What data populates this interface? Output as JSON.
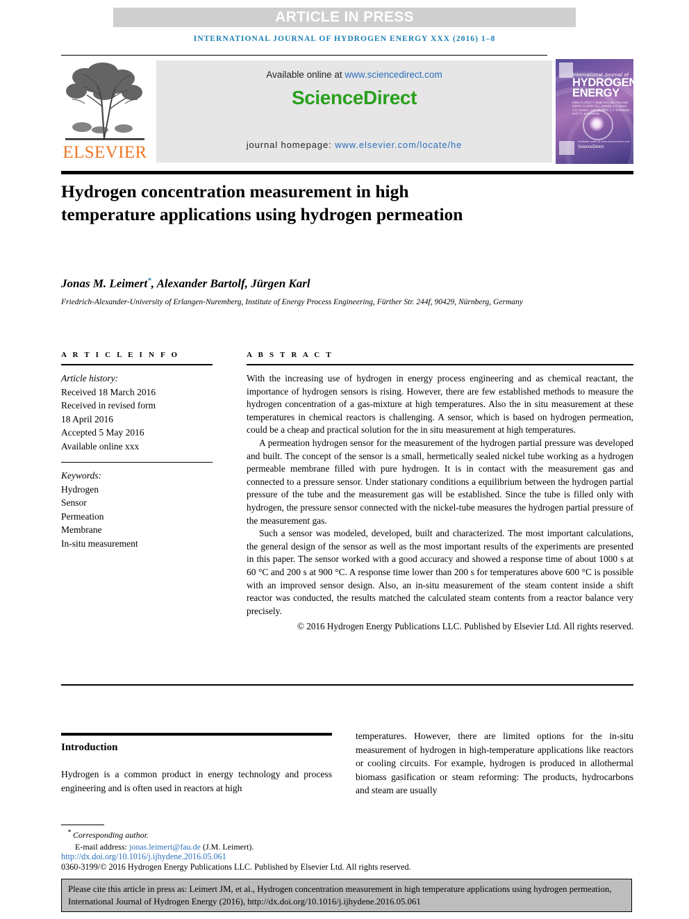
{
  "banner": {
    "label": "ARTICLE IN PRESS"
  },
  "running_head": "INTERNATIONAL JOURNAL OF HYDROGEN ENERGY XXX (2016) 1–8",
  "masthead": {
    "publisher_wordmark": "ELSEVIER",
    "available_online_prefix": "Available online at ",
    "available_online_link": "www.sciencedirect.com",
    "sciencedirect_logo": "ScienceDirect",
    "homepage_prefix": "journal homepage: ",
    "homepage_link": "www.elsevier.com/locate/he",
    "cover": {
      "line1": "International Journal of",
      "line2": "HYDROGEN",
      "line3": "ENERGY",
      "editors": "Editor-in-Chief: T. Nejat Veziroğlu\nAssociate Editors: S. Dunn, D.L. Damdin, A.A. Evers, A.C. Hansen, J.W. Sheffield, L.A. Kuznetsov and T.A. Semelsberg",
      "footer": "Available online at www.sciencedirect.com",
      "footer_brand": "ScienceDirect"
    }
  },
  "article": {
    "title": "Hydrogen concentration measurement in high temperature applications using hydrogen permeation",
    "authors": "Jonas M. Leimert",
    "author_marker": "*",
    "authors_rest": ", Alexander Bartolf, Jürgen Karl",
    "affiliation": "Friedrich-Alexander-University of Erlangen-Nuremberg, Institute of Energy Process Engineering, Fürther Str. 244f, 90429, Nürnberg, Germany"
  },
  "article_info": {
    "heading": "A R T I C L E   I N F O",
    "history_label": "Article history:",
    "history": [
      "Received 18 March 2016",
      "Received in revised form",
      "18 April 2016",
      "Accepted 5 May 2016",
      "Available online xxx"
    ],
    "keywords_label": "Keywords:",
    "keywords": [
      "Hydrogen",
      "Sensor",
      "Permeation",
      "Membrane",
      "In-situ measurement"
    ]
  },
  "abstract": {
    "heading": "A B S T R A C T",
    "paragraphs": [
      "With the increasing use of hydrogen in energy process engineering and as chemical reactant, the importance of hydrogen sensors is rising. However, there are few established methods to measure the hydrogen concentration of a gas-mixture at high temperatures. Also the in situ measurement at these temperatures in chemical reactors is challenging. A sensor, which is based on hydrogen permeation, could be a cheap and practical solution for the in situ measurement at high temperatures.",
      "A permeation hydrogen sensor for the measurement of the hydrogen partial pressure was developed and built. The concept of the sensor is a small, hermetically sealed nickel tube working as a hydrogen permeable membrane filled with pure hydrogen. It is in contact with the measurement gas and connected to a pressure sensor. Under stationary conditions a equilibrium between the hydrogen partial pressure of the tube and the measurement gas will be established. Since the tube is filled only with hydrogen, the pressure sensor connected with the nickel-tube measures the hydrogen partial pressure of the measurement gas.",
      "Such a sensor was modeled, developed, built and characterized. The most important calculations, the general design of the sensor as well as the most important results of the experiments are presented in this paper. The sensor worked with a good accuracy and showed a response time of about 1000 s at 60 °C and 200 s at 900 °C. A response time lower than 200 s for temperatures above 600 °C is possible with an improved sensor design. Also, an in-situ measurement of the steam content inside a shift reactor was conducted, the results matched the calculated steam contents from a reactor balance very precisely."
    ],
    "copyright": "© 2016 Hydrogen Energy Publications LLC. Published by Elsevier Ltd. All rights reserved."
  },
  "body": {
    "intro_heading": "Introduction",
    "left_text": "Hydrogen is a common product in energy technology and process engineering and is often used in reactors at high",
    "right_text": "temperatures. However, there are limited options for the in-situ measurement of hydrogen in high-temperature applications like reactors or cooling circuits. For example, hydrogen is produced in allothermal biomass gasification or steam reforming: The products, hydrocarbons and steam are usually"
  },
  "footnote": {
    "corresponding": "Corresponding author.",
    "marker": "*",
    "email_label": "E-mail address: ",
    "email": "jonas.leimert@fau.de",
    "email_suffix": " (J.M. Leimert).",
    "doi": "http://dx.doi.org/10.1016/j.ijhydene.2016.05.061",
    "issn_line": "0360-3199/© 2016 Hydrogen Energy Publications LLC. Published by Elsevier Ltd. All rights reserved."
  },
  "cite_box": {
    "text": "Please cite this article in press as: Leimert JM, et al., Hydrogen concentration measurement in high temperature applications using hydrogen permeation, International Journal of Hydrogen Energy (2016), http://dx.doi.org/10.1016/j.ijhydene.2016.05.061"
  },
  "colors": {
    "banner_bg": "#cfcfcf",
    "link_blue": "#2a6ebb",
    "journal_blue": "#1a7fb5",
    "elsevier_orange": "#ee7624",
    "sciencedirect_green": "#2aa01e",
    "cite_box_bg": "#bdbdbd",
    "masthead_bg": "#e6e6e6"
  }
}
